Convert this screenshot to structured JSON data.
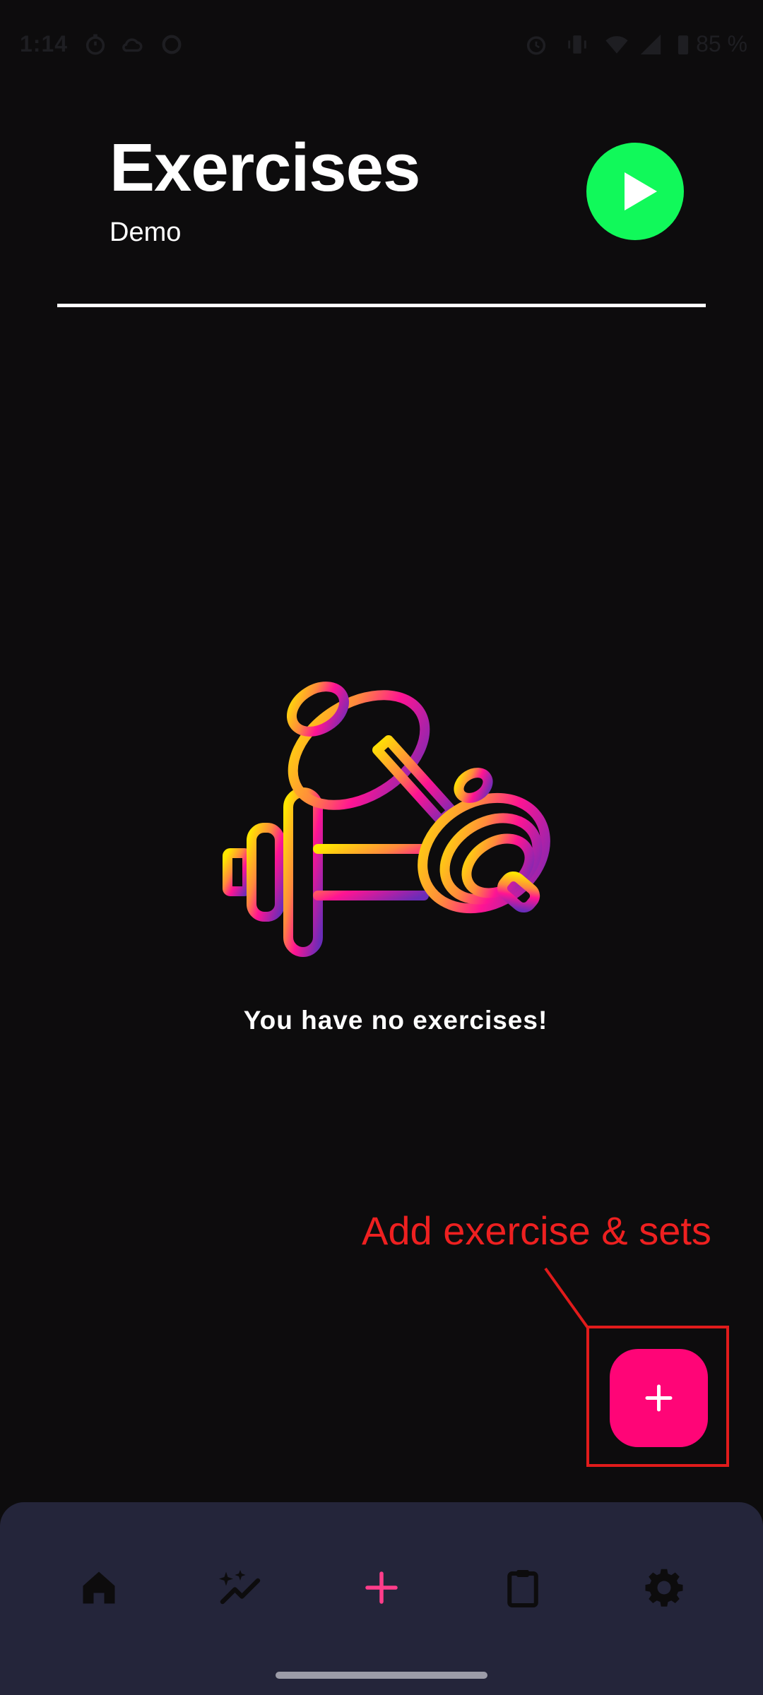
{
  "status_bar": {
    "time": "1:14",
    "battery": "85 %",
    "icons": [
      "stopwatch-icon",
      "cloud-icon",
      "circle-icon",
      "alarm-icon",
      "vibrate-icon",
      "wifi-icon",
      "signal-icon",
      "battery-icon"
    ]
  },
  "header": {
    "title": "Exercises",
    "subtitle": "Demo",
    "start_icon": "play-icon",
    "start_color": "#11f95a"
  },
  "empty_state": {
    "icon": "dumbbell-icon",
    "message": "You have no exercises!"
  },
  "annotation": {
    "label": "Add exercise & sets",
    "color": "#ee2020"
  },
  "fab": {
    "icon": "plus-icon",
    "color": "#ff0577"
  },
  "bottom_nav": {
    "background": "#24253a",
    "items": [
      {
        "icon": "home-icon",
        "active": false
      },
      {
        "icon": "chart-sparkle-icon",
        "active": false
      },
      {
        "icon": "plus-icon",
        "active": true
      },
      {
        "icon": "clipboard-icon",
        "active": false
      },
      {
        "icon": "gear-icon",
        "active": false
      }
    ],
    "active_color": "#ff3d8a",
    "inactive_color": "#0d0c0d"
  }
}
